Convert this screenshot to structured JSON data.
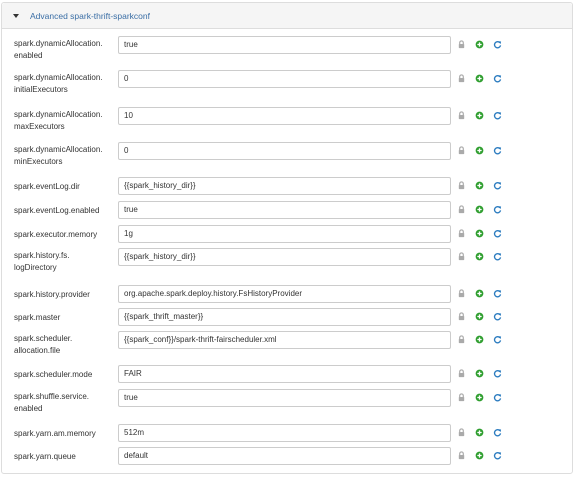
{
  "section": {
    "title": "Advanced spark-thrift-sparkconf"
  },
  "colors": {
    "link": "#3a6ea5",
    "lock": "#aaaaaa",
    "add": "#2e9e2e",
    "refresh": "#2a7bbf"
  },
  "properties": [
    {
      "name": "spark.dynamicAllocation.enabled",
      "label_lines": [
        "spark.dynamicAllocation.",
        "enabled"
      ],
      "value": "true"
    },
    {
      "name": "spark.dynamicAllocation.initialExecutors",
      "label_lines": [
        "spark.dynamicAllocation.",
        "initialExecutors"
      ],
      "value": "0"
    },
    {
      "name": "spark.dynamicAllocation.maxExecutors",
      "label_lines": [
        "spark.dynamicAllocation.",
        "maxExecutors"
      ],
      "value": "10"
    },
    {
      "name": "spark.dynamicAllocation.minExecutors",
      "label_lines": [
        "spark.dynamicAllocation.",
        "minExecutors"
      ],
      "value": "0"
    },
    {
      "name": "spark.eventLog.dir",
      "label_lines": [
        "spark.eventLog.dir"
      ],
      "value": "{{spark_history_dir}}"
    },
    {
      "name": "spark.eventLog.enabled",
      "label_lines": [
        "spark.eventLog.enabled"
      ],
      "value": "true"
    },
    {
      "name": "spark.executor.memory",
      "label_lines": [
        "spark.executor.memory"
      ],
      "value": "1g"
    },
    {
      "name": "spark.history.fs.logDirectory",
      "label_lines": [
        "spark.history.fs.",
        "logDirectory"
      ],
      "value": "{{spark_history_dir}}"
    },
    {
      "name": "spark.history.provider",
      "label_lines": [
        "spark.history.provider"
      ],
      "value": "org.apache.spark.deploy.history.FsHistoryProvider"
    },
    {
      "name": "spark.master",
      "label_lines": [
        "spark.master"
      ],
      "value": "{{spark_thrift_master}}"
    },
    {
      "name": "spark.scheduler.allocation.file",
      "label_lines": [
        "spark.scheduler.",
        "allocation.file"
      ],
      "value": "{{spark_conf}}/spark-thrift-fairscheduler.xml"
    },
    {
      "name": "spark.scheduler.mode",
      "label_lines": [
        "spark.scheduler.mode"
      ],
      "value": "FAIR"
    },
    {
      "name": "spark.shuffle.service.enabled",
      "label_lines": [
        "spark.shuffle.service.",
        "enabled"
      ],
      "value": "true"
    },
    {
      "name": "spark.yarn.am.memory",
      "label_lines": [
        "spark.yarn.am.memory"
      ],
      "value": "512m"
    },
    {
      "name": "spark.yarn.queue",
      "label_lines": [
        "spark.yarn.queue"
      ],
      "value": "default"
    }
  ]
}
